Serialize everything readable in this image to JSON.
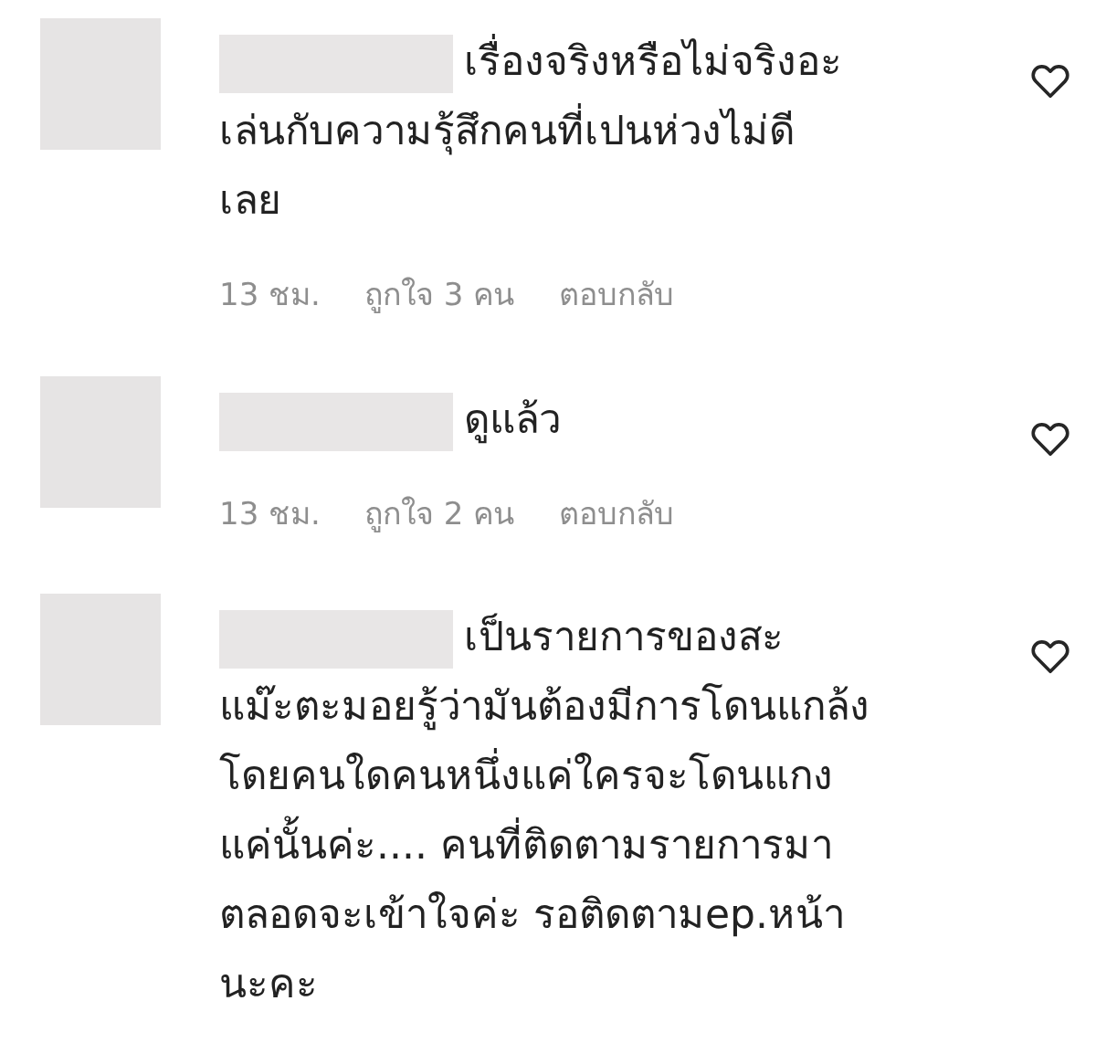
{
  "comments": [
    {
      "lines": [
        "เรื่องจริงหรือไม่จริงอะ",
        "เล่นกับความรุ้สึกคนที่เปนห่วงไม่ดี",
        "เลย"
      ],
      "time": "13 ชม.",
      "likes": "ถูกใจ 3 คน",
      "reply": "ตอบกลับ"
    },
    {
      "lines": [
        "ดูแล้ว"
      ],
      "time": "13 ชม.",
      "likes": "ถูกใจ 2 คน",
      "reply": "ตอบกลับ"
    },
    {
      "lines": [
        "เป็นรายการของสะ",
        "แม๊ะตะมอยรู้ว่ามันต้องมีการโดนแกล้ง",
        "โดยคนใดคนหนึ่งแค่ใครจะโดนแกง",
        "แค่นั้นค่ะ.... คนที่ติดตามรายการมา",
        "ตลอดจะเข้าใจค่ะ รอติดตามep.หน้า",
        "นะคะ"
      ]
    }
  ]
}
